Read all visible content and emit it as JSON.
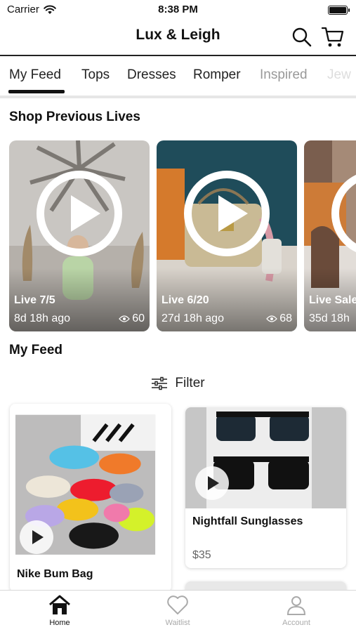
{
  "status": {
    "carrier": "Carrier",
    "time": "8:38 PM"
  },
  "header": {
    "title": "Lux & Leigh"
  },
  "tabs": [
    {
      "label": "My Feed",
      "active": true
    },
    {
      "label": "Tops"
    },
    {
      "label": "Dresses"
    },
    {
      "label": "Romper"
    },
    {
      "label": "Inspired"
    },
    {
      "label": "Jew"
    }
  ],
  "sections": {
    "previous_lives": "Shop Previous Lives",
    "my_feed": "My Feed"
  },
  "lives": [
    {
      "title": "Live 7/5",
      "ago": "8d 18h ago",
      "views": "60"
    },
    {
      "title": "Live 6/20",
      "ago": "27d 18h ago",
      "views": "68"
    },
    {
      "title": "Live Sale",
      "ago": "35d 18h",
      "views": ""
    }
  ],
  "filter": {
    "label": "Filter"
  },
  "products": [
    {
      "name": "Nike Bum Bag",
      "price": ""
    },
    {
      "name": "Nightfall Sunglasses",
      "price": "$35"
    }
  ],
  "nav": {
    "home": "Home",
    "waitlist": "Waitlist",
    "account": "Account"
  },
  "colors": {
    "accent": "#111111",
    "muted": "#aaaaaa"
  }
}
